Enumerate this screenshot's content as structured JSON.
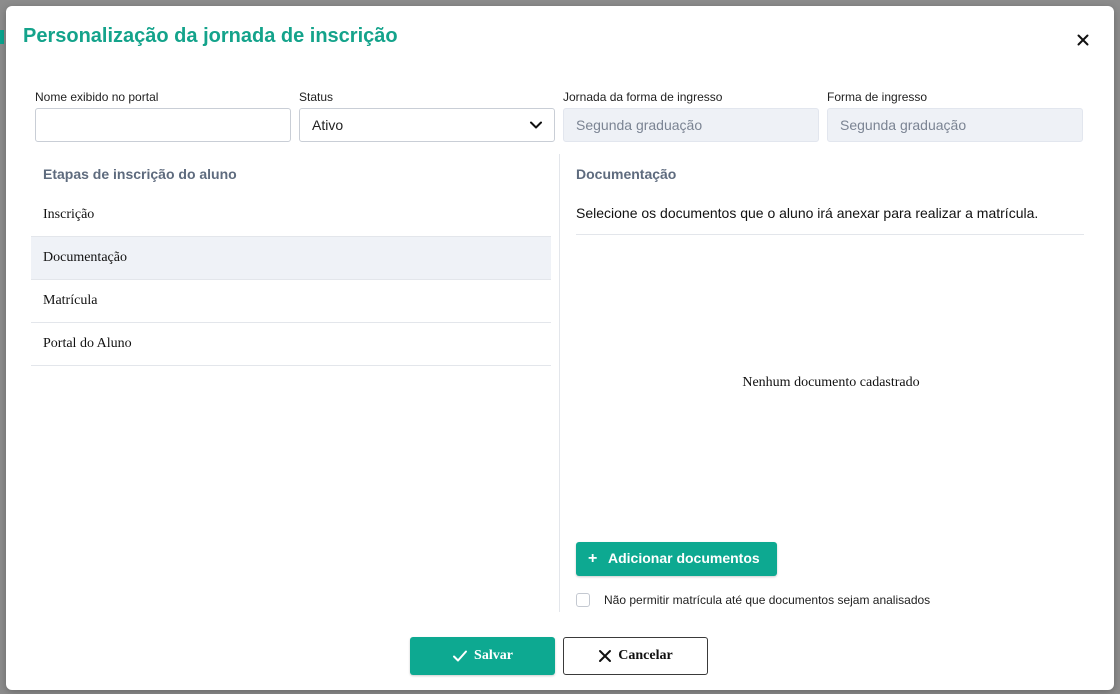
{
  "modal": {
    "title": "Personalização da jornada de inscrição",
    "close_icon": "close-icon"
  },
  "fields": {
    "portal_name": {
      "label": "Nome exibido no portal",
      "value": "",
      "placeholder": ""
    },
    "status": {
      "label": "Status",
      "value": "Ativo",
      "icon": "chevron-down-icon"
    },
    "journey": {
      "label": "Jornada da forma de ingresso",
      "value": "Segunda graduação"
    },
    "entry_form": {
      "label": "Forma de ingresso",
      "value": "Segunda graduação"
    }
  },
  "steps": {
    "heading": "Etapas de inscrição do aluno",
    "items": [
      {
        "label": "Inscrição",
        "active": false
      },
      {
        "label": "Documentação",
        "active": true
      },
      {
        "label": "Matrícula",
        "active": false
      },
      {
        "label": "Portal do Aluno",
        "active": false
      }
    ]
  },
  "documentation": {
    "heading": "Documentação",
    "description": "Selecione os documentos que o aluno irá anexar para realizar a matrícula.",
    "empty_message": "Nenhum documento cadastrado",
    "add_button": {
      "label": "Adicionar documentos",
      "icon": "plus-icon"
    },
    "block_checkbox": {
      "label": "Não permitir matrícula até que documentos sejam analisados",
      "checked": false
    }
  },
  "footer": {
    "save_label": "Salvar",
    "save_icon": "check-icon",
    "cancel_label": "Cancelar",
    "cancel_icon": "close-icon"
  },
  "colors": {
    "accent": "#0da991",
    "title": "#14a38b",
    "heading": "#5e6b7e",
    "active_row": "#eff2f7",
    "disabled_field": "#eef1f6"
  }
}
